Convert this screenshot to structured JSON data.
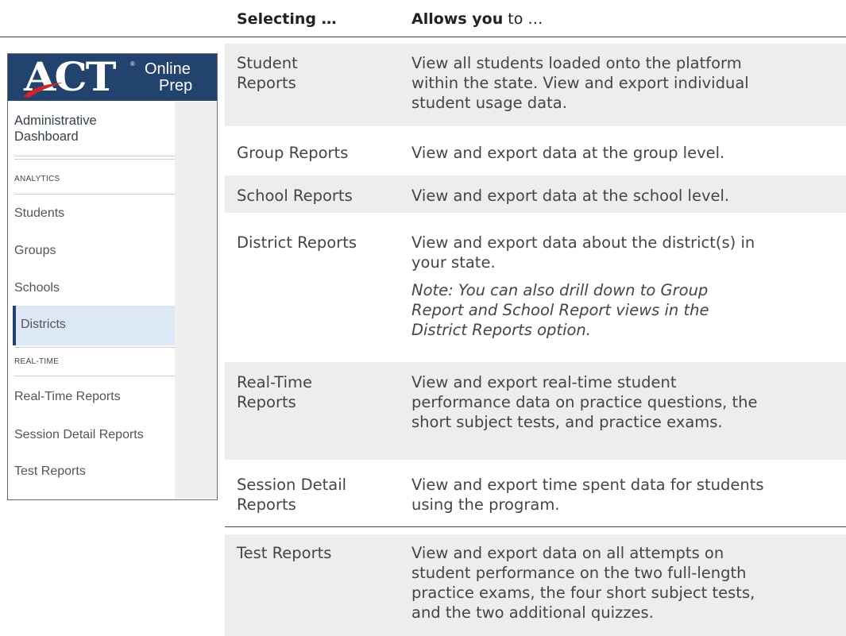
{
  "header": {
    "col1": "Selecting …",
    "col2_bold": "Allows you",
    "col2_rest": " to …"
  },
  "sidebar": {
    "logo": {
      "act": "ACT",
      "registered": "®",
      "online": "Online",
      "prep": "Prep"
    },
    "title_line1": "Administrative",
    "title_line2": "Dashboard",
    "analytics_label": "ANALYTICS",
    "realtime_label": "REAL-TIME",
    "items": [
      {
        "label": "Students"
      },
      {
        "label": "Groups"
      },
      {
        "label": "Schools"
      },
      {
        "label": "Districts"
      },
      {
        "label": "Real-Time Reports"
      },
      {
        "label": "Session Detail Reports"
      },
      {
        "label": "Test Reports"
      }
    ],
    "active_item": "Districts",
    "colors": {
      "brand": "#21436d",
      "active_bg": "#dce8f5"
    }
  },
  "table": {
    "rows": [
      {
        "selecting": [
          "Student",
          "Reports"
        ],
        "allows": [
          "View all students loaded onto the platform",
          "within the state. View and export individual",
          "student usage data."
        ]
      },
      {
        "selecting": [
          "Group Reports"
        ],
        "allows": [
          "View and export data at the group level."
        ]
      },
      {
        "selecting": [
          "School Reports"
        ],
        "allows": [
          "View and export data at the school level."
        ]
      },
      {
        "selecting": [
          "District Reports"
        ],
        "allows": [
          "View and export data about the district(s) in",
          "your state."
        ],
        "note": [
          "Note: You can also drill down to Group",
          "Report and School Report views in the",
          "District Reports option."
        ]
      },
      {
        "selecting": [
          "Real-Time",
          "Reports"
        ],
        "allows": [
          "View and export real-time student",
          "performance data on practice questions, the",
          "short subject tests, and practice exams."
        ]
      },
      {
        "selecting": [
          "Session Detail",
          "Reports"
        ],
        "allows": [
          "View and export time spent data for students",
          "using the program."
        ]
      },
      {
        "selecting": [
          "Test Reports"
        ],
        "allows": [
          "View and export data on all attempts on",
          "student performance on the two full-length",
          "practice exams, the four short subject tests,",
          "and the two additional quizzes."
        ]
      }
    ],
    "colors": {
      "shade": "#ededed",
      "rule": "#2f4e7a",
      "text": "#454545"
    }
  }
}
